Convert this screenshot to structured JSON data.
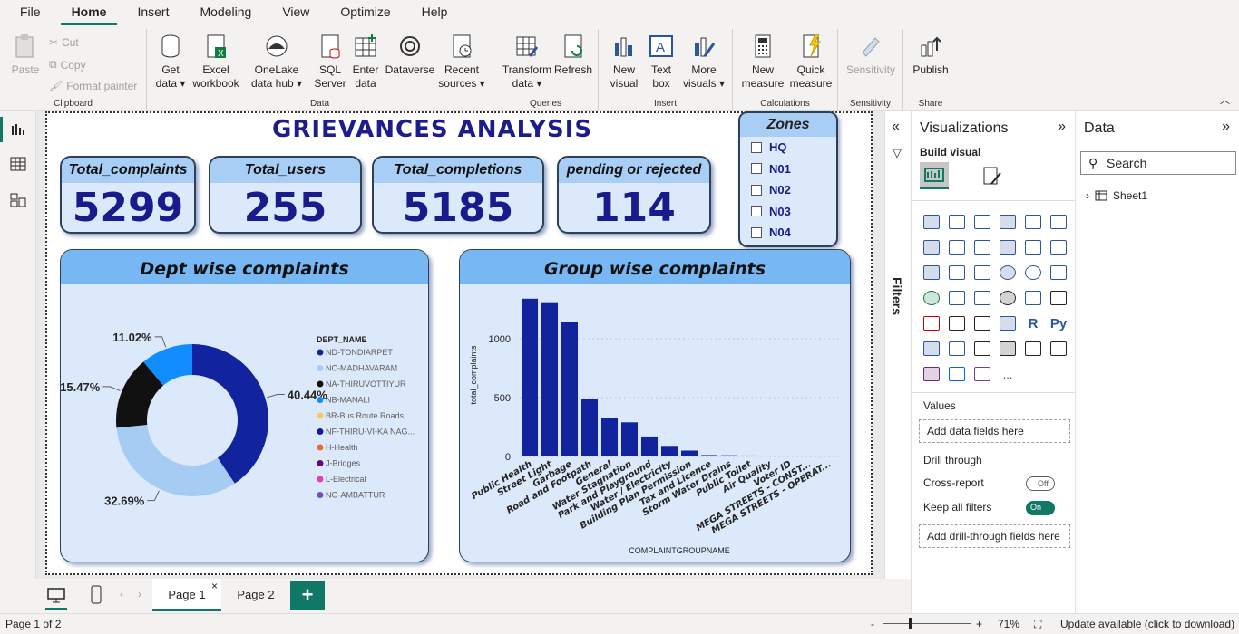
{
  "menu": [
    "File",
    "Home",
    "Insert",
    "Modeling",
    "View",
    "Optimize",
    "Help"
  ],
  "ribbon": {
    "clipboard": {
      "label": "Clipboard",
      "paste": "Paste",
      "cut": "Cut",
      "copy": "Copy",
      "format_painter": "Format painter"
    },
    "data": {
      "label": "Data",
      "get_data": "Get data",
      "excel": "Excel workbook",
      "onelake": "OneLake data hub",
      "sql": "SQL Server",
      "enter": "Enter data",
      "dataverse": "Dataverse",
      "recent": "Recent sources"
    },
    "queries": {
      "label": "Queries",
      "transform": "Transform data",
      "refresh": "Refresh"
    },
    "insert": {
      "label": "Insert",
      "new_visual": "New visual",
      "text_box": "Text box",
      "more_visuals": "More visuals"
    },
    "calculations": {
      "label": "Calculations",
      "new_measure": "New measure",
      "quick_measure": "Quick measure"
    },
    "sensitivity": {
      "label": "Sensitivity",
      "button": "Sensitivity"
    },
    "share": {
      "label": "Share",
      "publish": "Publish"
    }
  },
  "report": {
    "title": "GRIEVANCES ANALYSIS",
    "cards": [
      {
        "label": "Total_complaints",
        "value": "5299"
      },
      {
        "label": "Total_users",
        "value": "255"
      },
      {
        "label": "Total_completions",
        "value": "5185"
      },
      {
        "label": "pending or rejected",
        "value": "114"
      }
    ],
    "zones": {
      "title": "Zones",
      "items": [
        "HQ",
        "N01",
        "N02",
        "N03",
        "N04"
      ]
    },
    "dept_panel_title": "Dept wise complaints",
    "group_panel_title": "Group wise complaints"
  },
  "chart_data": [
    {
      "type": "pie",
      "donut": true,
      "title": "Dept wise complaints",
      "legend_title": "DEPT_NAME",
      "legend_position": "right",
      "legend": [
        "ND-TONDIARPET",
        "NC-MADHAVARAM",
        "NA-THIRUVOTTIYUR",
        "NB-MANALI",
        "BR-Bus Route Roads",
        "NF-THIRU-VI-KA NAG...",
        "H-Health",
        "J-Bridges",
        "L-Electrical",
        "NG-AMBATTUR"
      ],
      "legend_colors": [
        "#12239e",
        "#a7ccf3",
        "#111111",
        "#118dff",
        "#f6c86a",
        "#16179a",
        "#e66c37",
        "#6b007b",
        "#e044a7",
        "#744ec2"
      ],
      "slices": [
        {
          "label": "ND-TONDIARPET",
          "value": 40.44,
          "color": "#12239e"
        },
        {
          "label": "NC-MADHAVARAM",
          "value": 32.69,
          "color": "#a7ccf3"
        },
        {
          "label": "NA-THIRUVOTTIYUR",
          "value": 15.47,
          "color": "#111111"
        },
        {
          "label": "NB-MANALI",
          "value": 11.02,
          "color": "#118dff"
        }
      ],
      "data_labels": [
        "40.44%",
        "32.69%",
        "15.47%",
        "11.02%"
      ]
    },
    {
      "type": "bar",
      "title": "Group wise complaints",
      "xlabel": "COMPLAINTGROUPNAME",
      "ylabel": "total_complaints",
      "ylim": [
        0,
        1400
      ],
      "yticks": [
        0,
        500,
        1000
      ],
      "grid": true,
      "color": "#12239e",
      "categories": [
        "Public Health",
        "Street Light",
        "Garbage",
        "Road and Footpath",
        "General",
        "Water Stagnation",
        "Park and Playground",
        "Water / Electricity",
        "Building Plan Permission",
        "Tax and Licence",
        "Storm Water Drains",
        "Public Toilet",
        "Air Quality",
        "Voter ID",
        "MEGA STREETS - CONST...",
        "MEGA STREETS - OPERAT..."
      ],
      "values": [
        1340,
        1310,
        1140,
        490,
        330,
        290,
        170,
        90,
        50,
        12,
        10,
        8,
        5,
        4,
        3,
        2
      ]
    }
  ],
  "filters_label": "Filters",
  "viz": {
    "title": "Visualizations",
    "build_visual": "Build visual",
    "values_label": "Values",
    "add_data": "Add data fields here",
    "drill_through": "Drill through",
    "cross_report": "Cross-report",
    "cross_state": "Off",
    "keep_filters": "Keep all filters",
    "keep_state": "On",
    "add_drill": "Add drill-through fields here",
    "r_label": "R",
    "py_label": "Py",
    "more": "..."
  },
  "datapane": {
    "title": "Data",
    "search": "Search",
    "table": "Sheet1"
  },
  "tabs": [
    "Page 1",
    "Page 2"
  ],
  "status": {
    "page": "Page 1 of 2",
    "zoom": "71%",
    "update": "Update available (click to download)"
  }
}
